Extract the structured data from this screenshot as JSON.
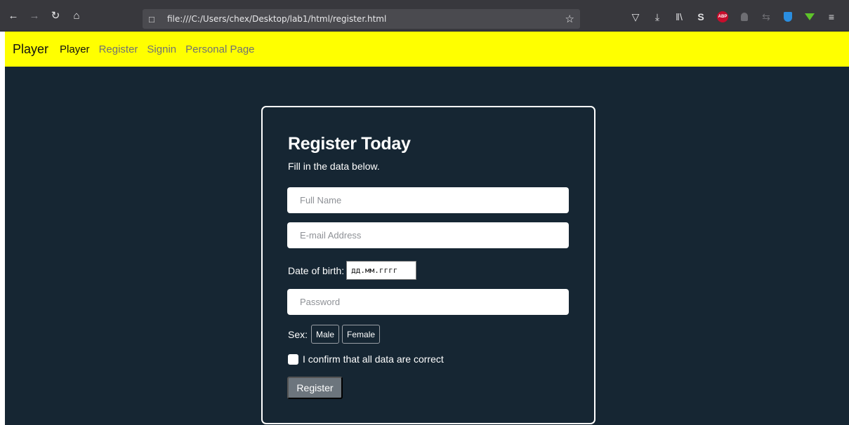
{
  "browser": {
    "url": "file:///C:/Users/chex/Desktop/lab1/html/register.html",
    "icons": {
      "back": "←",
      "forward": "→",
      "reload": "↻",
      "home": "⌂",
      "page": "□",
      "star": "☆",
      "pocket": "▽",
      "download": "⤓",
      "library": "‖\\",
      "sync": "S",
      "adblock": "ABP",
      "menu": "≡"
    }
  },
  "navbar": {
    "brand": "Player",
    "links": [
      {
        "label": "Player",
        "active": true
      },
      {
        "label": "Register",
        "active": false
      },
      {
        "label": "Signin",
        "active": false
      },
      {
        "label": "Personal Page",
        "active": false
      }
    ]
  },
  "form": {
    "title": "Register Today",
    "subtitle": "Fill in the data below.",
    "full_name_placeholder": "Full Name",
    "email_placeholder": "E-mail Address",
    "dob_label": "Date of birth:",
    "dob_value": "дд.мм.гггг",
    "password_placeholder": "Password",
    "sex_label": "Sex:",
    "sex_options": [
      "Male",
      "Female"
    ],
    "confirm_label": "I confirm that all data are correct",
    "submit_label": "Register"
  },
  "colors": {
    "navbar": "#ffff00",
    "page_bg": "#162633",
    "button": "#6c757d"
  }
}
